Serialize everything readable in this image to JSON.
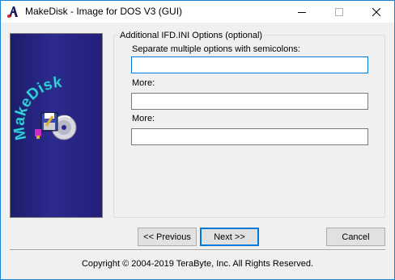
{
  "window": {
    "title": "MakeDisk - Image for DOS V3 (GUI)",
    "icon": "makedisk-app-icon",
    "controls": [
      "minimize-icon",
      "maximize-icon",
      "close-icon"
    ]
  },
  "banner": {
    "logo_text": "MakeDisk",
    "graphic": "floppy-and-cd-icon"
  },
  "options": {
    "group_title": "Additional IFD.INI Options (optional)",
    "fields": [
      {
        "label": "Separate multiple options with semicolons:",
        "value": ""
      },
      {
        "label": "More:",
        "value": ""
      },
      {
        "label": "More:",
        "value": ""
      }
    ]
  },
  "buttons": {
    "back": "<< Previous",
    "next": "Next >>",
    "cancel": "Cancel"
  },
  "footer": {
    "copyright": "Copyright © 2004-2019 TeraByte, Inc.  All Rights Reserved."
  },
  "colors": {
    "accent": "#0078d7",
    "banner_bg": "#2a288a",
    "logo_text": "#3fd3e6"
  }
}
